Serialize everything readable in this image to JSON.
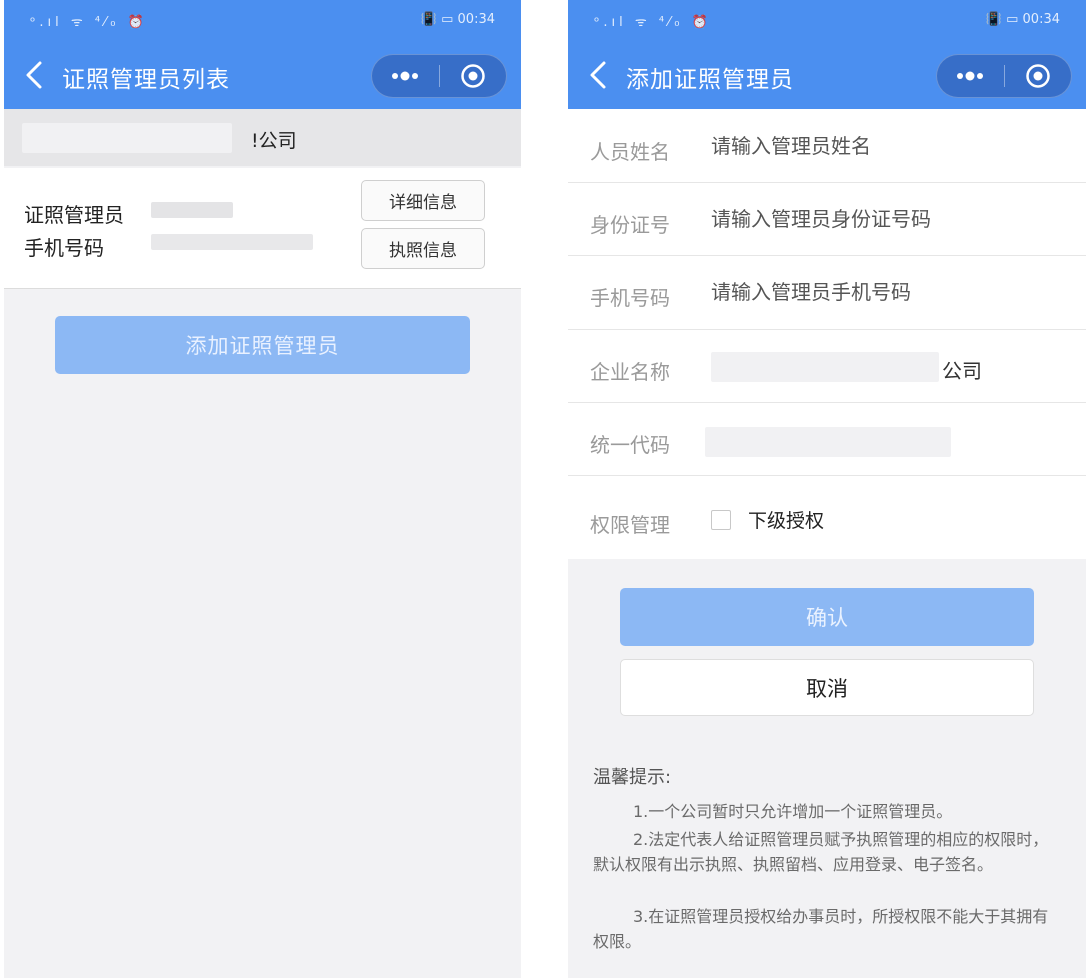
{
  "status_bar": {
    "left": "ᵒ.ıl ᯤ ⁴⁄₀ ⏰",
    "right": "📳 ▭ 00:34"
  },
  "left_screen": {
    "nav_title": "证照管理员列表",
    "company_suffix": "!公司",
    "admin_label": "证照管理员",
    "phone_label": "手机号码",
    "detail_button": "详细信息",
    "license_button": "执照信息",
    "add_button": "添加证照管理员"
  },
  "right_screen": {
    "nav_title": "添加证照管理员",
    "form": {
      "name_label": "人员姓名",
      "name_placeholder": "请输入管理员姓名",
      "id_label": "身份证号",
      "id_placeholder": "请输入管理员身份证号码",
      "phone_label": "手机号码",
      "phone_placeholder": "请输入管理员手机号码",
      "company_label": "企业名称",
      "company_suffix": "公司",
      "code_label": "统一代码",
      "perm_label": "权限管理",
      "perm_option": "下级授权"
    },
    "confirm_button": "确认",
    "cancel_button": "取消",
    "tips": {
      "title": "温馨提示:",
      "items": [
        "1.一个公司暂时只允许增加一个证照管理员。",
        "2.法定代表人给证照管理员赋予执照管理的相应的权限时，默认权限有出示执照、执照留档、应用登录、电子签名。",
        "3.在证照管理员授权给办事员时，所授权限不能大于其拥有权限。"
      ]
    }
  },
  "colors": {
    "header_blue": "#4b8ff0",
    "button_blue_disabled": "#8cb8f4"
  },
  "icons": [
    "back-chevron-icon",
    "more-dots-icon",
    "close-target-icon",
    "checkbox-icon"
  ]
}
